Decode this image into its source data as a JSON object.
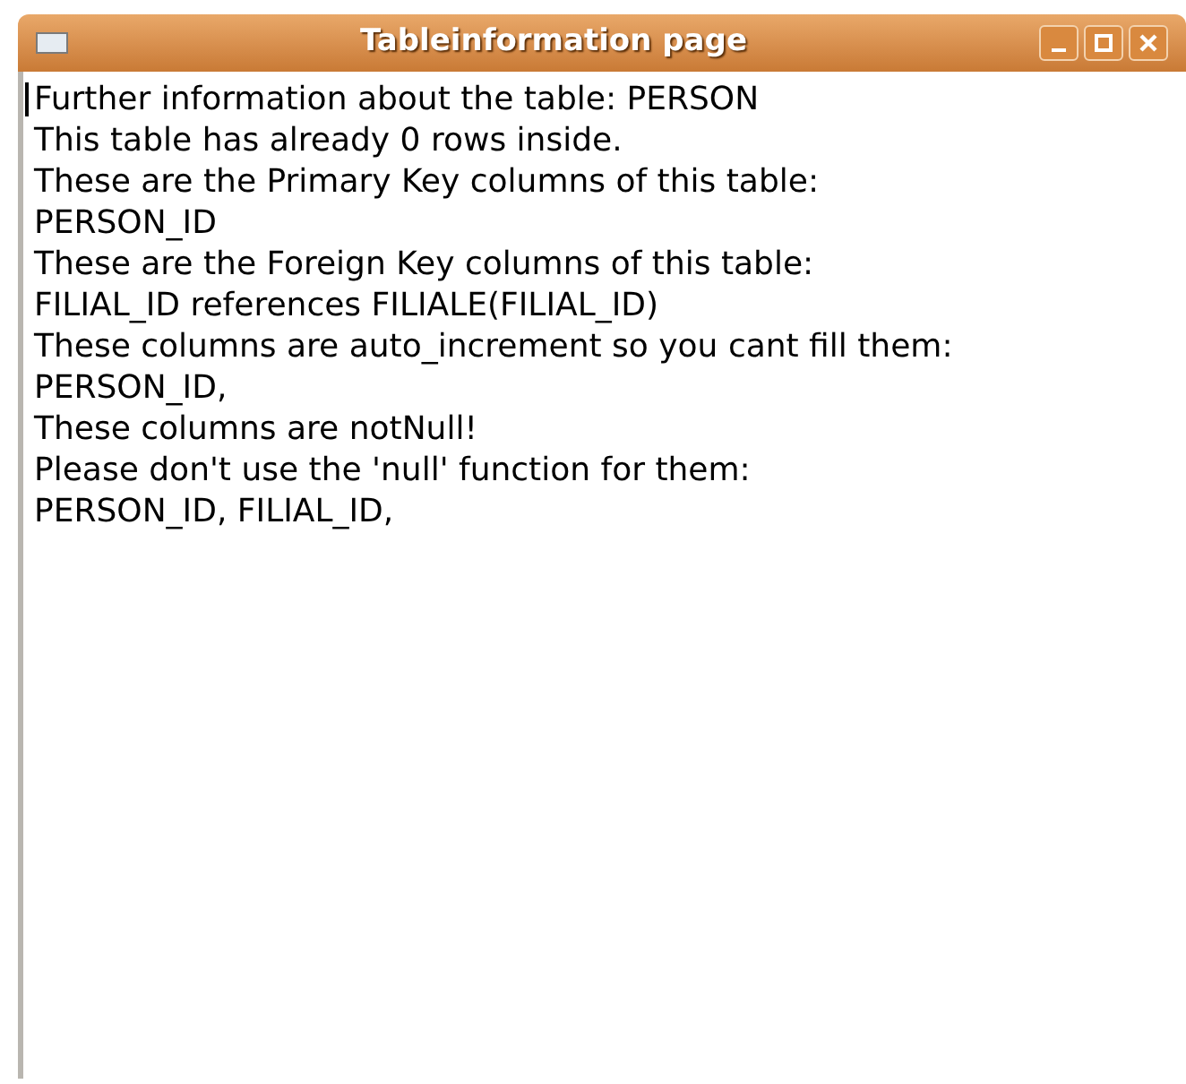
{
  "window": {
    "title": "Tableinformation page"
  },
  "text_area": {
    "lines": [
      "Further information about the table: PERSON",
      "This table has already 0 rows inside.",
      "These are the Primary Key columns of this table:",
      "PERSON_ID",
      "These are the Foreign Key columns of this table:",
      "FILIAL_ID references FILIALE(FILIAL_ID)",
      "These columns are auto_increment so you cant fill them:",
      "PERSON_ID,",
      "These columns are notNull!",
      "Please don't use the 'null' function for them:",
      "PERSON_ID, FILIAL_ID,"
    ]
  }
}
